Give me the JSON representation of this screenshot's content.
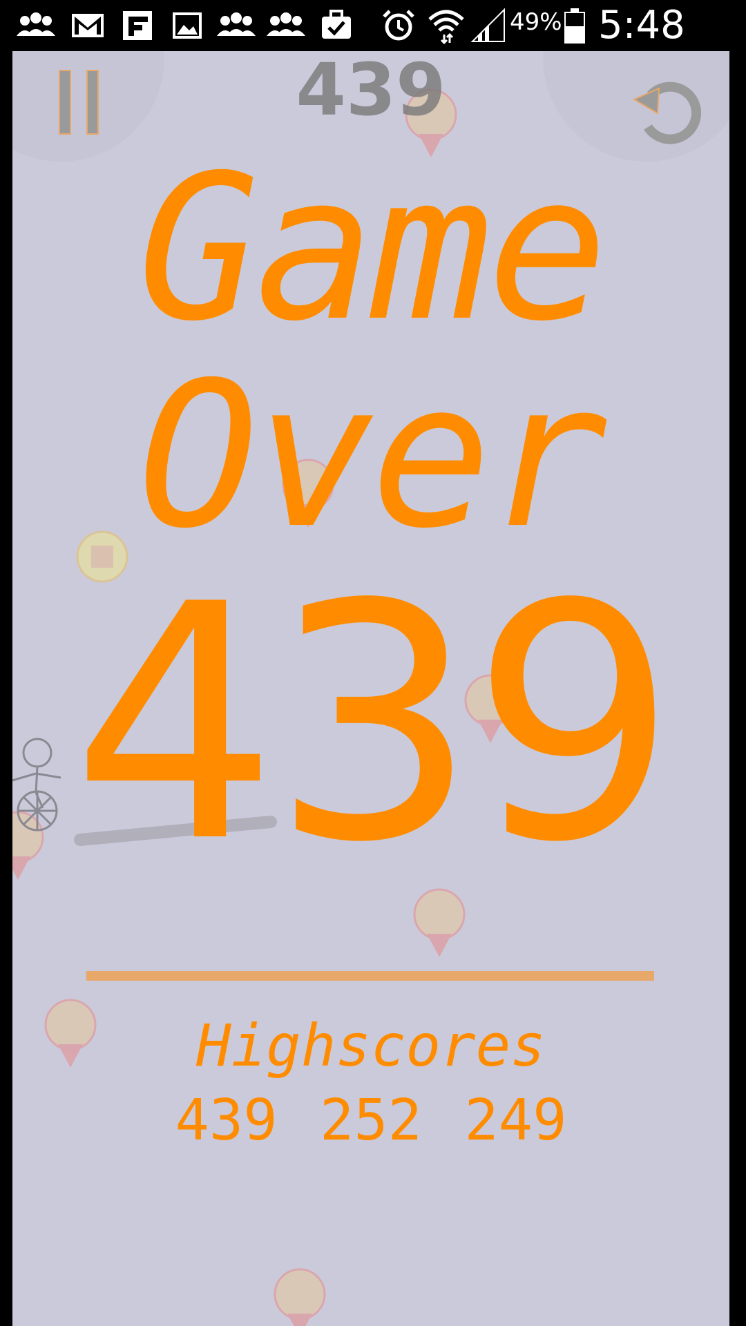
{
  "status_bar": {
    "icons": [
      "people-icon",
      "gmail-icon",
      "flipboard-icon",
      "gallery-icon",
      "people-icon",
      "people-icon",
      "briefcase-check-icon",
      "alarm-icon",
      "wifi-icon",
      "signal-icon",
      "battery-icon"
    ],
    "battery_percent": "49%",
    "time": "5:48 PM"
  },
  "hud": {
    "current_score": "439",
    "pause_icon": "pause-icon",
    "restart_icon": "restart-icon"
  },
  "game_over": {
    "title_line1": "Game",
    "title_line2": "Over",
    "final_score": "439"
  },
  "highscores": {
    "label": "Highscores",
    "values_text": "439 252 249",
    "values": [
      439,
      252,
      249
    ]
  },
  "colors": {
    "accent": "#ff8c00",
    "background": "#cbcadb",
    "divider": "#e8a869",
    "balloon": "#e8c79a",
    "balloon_tail": "#e88a8a",
    "coin": "#f0e68c"
  },
  "scene": {
    "objects": [
      "balloon",
      "balloon",
      "balloon",
      "balloon",
      "balloon",
      "balloon",
      "balloon",
      "coin",
      "stickman-unicyclist",
      "ramp"
    ]
  }
}
